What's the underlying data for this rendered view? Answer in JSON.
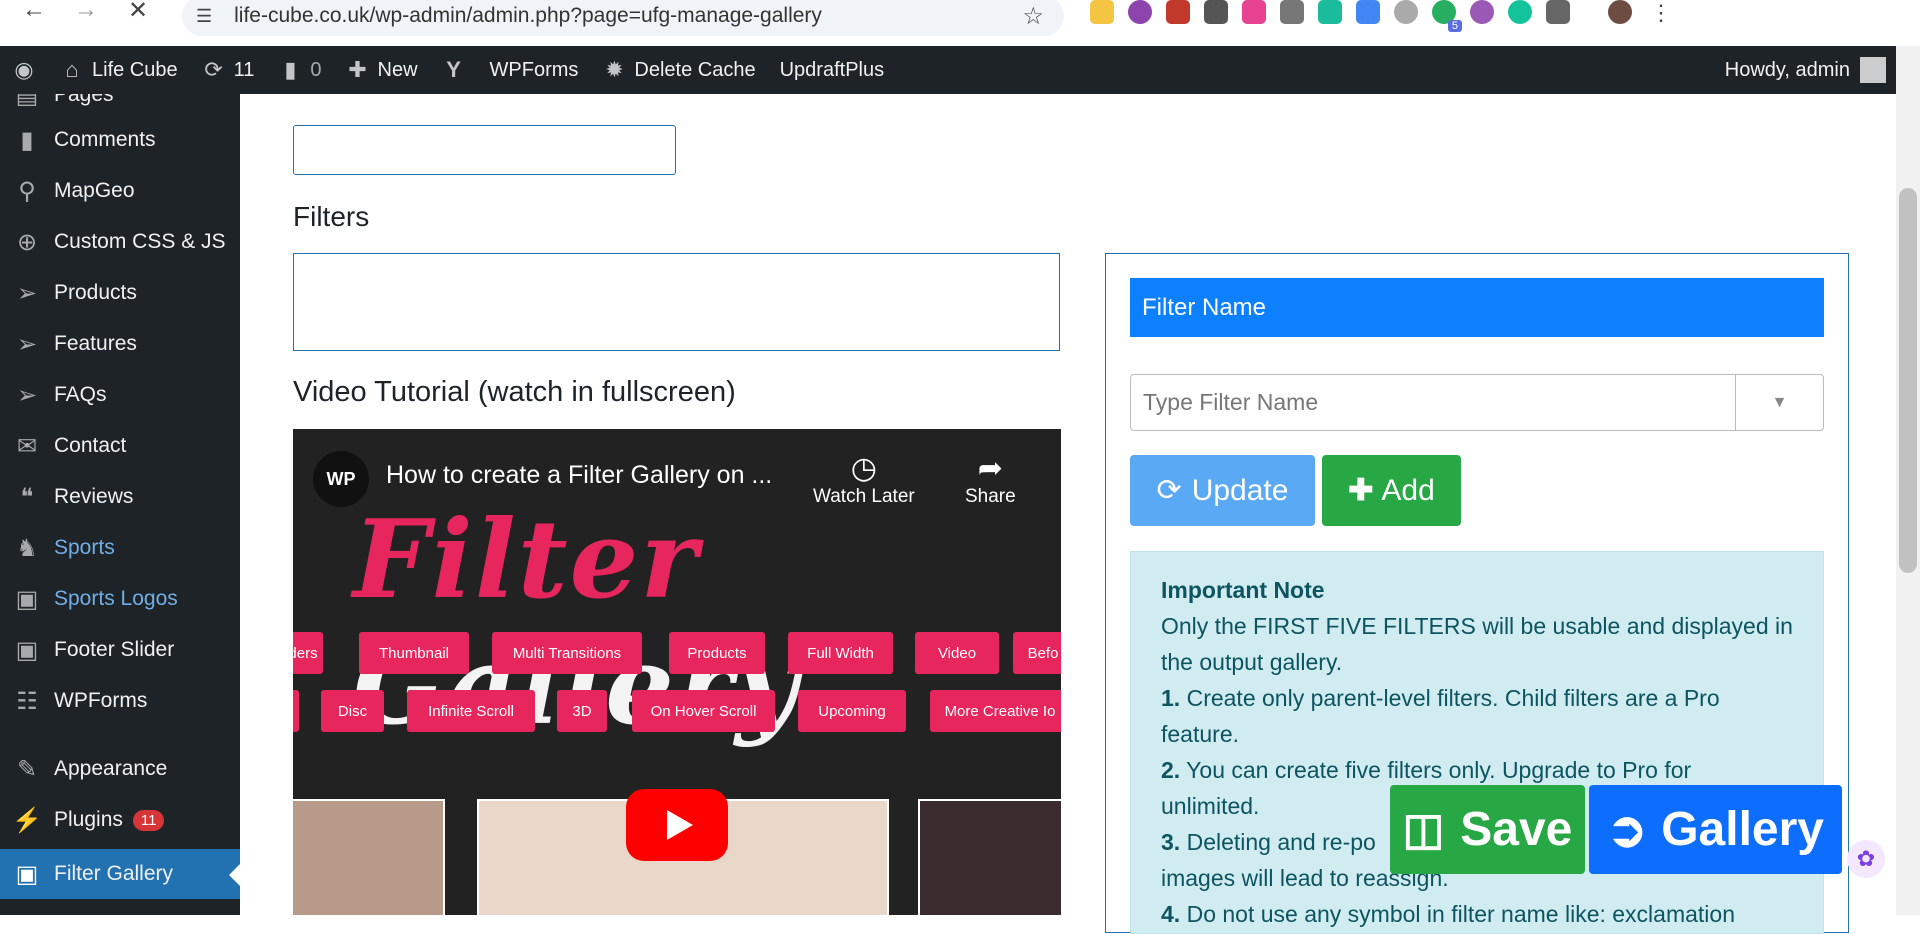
{
  "browser": {
    "url": "life-cube.co.uk/wp-admin/admin.php?page=ufg-manage-gallery",
    "extension_badge": "5"
  },
  "adminbar": {
    "site_name": "Life Cube",
    "updates_count": "11",
    "comments_count": "0",
    "new_label": "New",
    "wpforms_label": "WPForms",
    "delete_cache_label": "Delete Cache",
    "updraftplus_label": "UpdraftPlus",
    "howdy": "Howdy, admin"
  },
  "sidebar": {
    "items": [
      {
        "label": "Pages",
        "icon": "pages-icon"
      },
      {
        "label": "Comments",
        "icon": "comment-icon"
      },
      {
        "label": "MapGeo",
        "icon": "map-pin-icon"
      },
      {
        "label": "Custom CSS & JS",
        "icon": "plus-circle-icon"
      },
      {
        "label": "Products",
        "icon": "pin-icon"
      },
      {
        "label": "Features",
        "icon": "pin-icon"
      },
      {
        "label": "FAQs",
        "icon": "pin-icon"
      },
      {
        "label": "Contact",
        "icon": "mail-icon"
      },
      {
        "label": "Reviews",
        "icon": "quote-icon"
      },
      {
        "label": "Sports",
        "icon": "horse-icon"
      },
      {
        "label": "Sports Logos",
        "icon": "images-icon"
      },
      {
        "label": "Footer Slider",
        "icon": "images-icon"
      },
      {
        "label": "WPForms",
        "icon": "form-icon"
      },
      {
        "label": "Appearance",
        "icon": "brush-icon"
      },
      {
        "label": "Plugins",
        "icon": "plug-icon",
        "badge": "11"
      },
      {
        "label": "Filter Gallery",
        "icon": "gallery-icon"
      }
    ]
  },
  "main": {
    "filters_heading": "Filters",
    "video_heading": "Video Tutorial (watch in fullscreen)",
    "video": {
      "title": "How to create a Filter Gallery on ...",
      "channel_logo": "WP",
      "watch_later": "Watch Later",
      "share": "Share",
      "big_title_1": "Filter",
      "big_title_2": "Gallery",
      "tags_row1": [
        "ders",
        "Thumbnail",
        "Multi Transitions",
        "Products",
        "Full Width",
        "Video",
        "Befo"
      ],
      "tags_row2": [
        "",
        "Disc",
        "Infinite Scroll",
        "3D",
        "On Hover Scroll",
        "Upcoming",
        "More Creative Io"
      ]
    }
  },
  "panel": {
    "header": "Filter Name",
    "input_placeholder": "Type Filter Name",
    "update_label": "Update",
    "add_label": "Add",
    "note_title": "Important Note",
    "note_intro": "Only the FIRST FIVE FILTERS will be usable and displayed in the output gallery.",
    "note_items": [
      {
        "num": "1.",
        "text": "Create only parent-level filters. Child filters are a Pro feature."
      },
      {
        "num": "2.",
        "text": "You can create five filters only. Upgrade to Pro for unlimited."
      },
      {
        "num": "3.",
        "text": "Deleting and re-po"
      },
      {
        "num": "",
        "text": "images will lead to reassign."
      },
      {
        "num": "4.",
        "text": "Do not use any symbol in filter name like: exclamation"
      }
    ]
  },
  "floating": {
    "save_label": "Save",
    "gallery_label": "Gallery"
  },
  "colors": {
    "admin_bar": "#1d2327",
    "current_menu": "#2271b1",
    "panel_header": "#0d80ff",
    "add_green": "#28a745",
    "update_blue": "#5aa9f5",
    "note_bg": "#d1ecf1",
    "tag_pink": "#e8265e"
  }
}
